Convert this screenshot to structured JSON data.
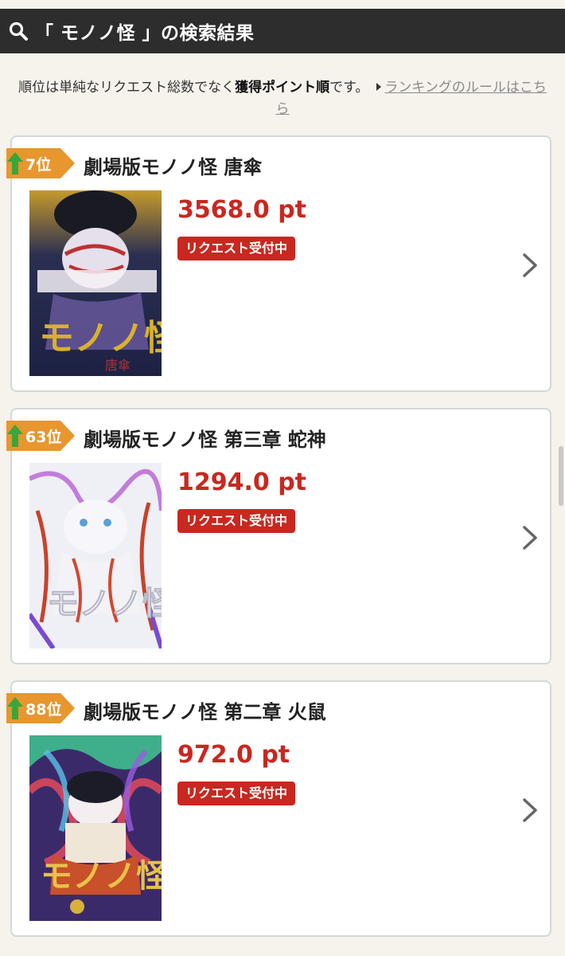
{
  "header": {
    "title": "「 モノノ怪 」の検索結果",
    "icon": "search-icon"
  },
  "notice": {
    "text_before": "順位は単純なリクエスト総数でなく",
    "text_bold": "獲得ポイント順",
    "text_after": "です。",
    "link_text": "ランキングのルールはこちら"
  },
  "results": [
    {
      "rank": "7位",
      "title": "劇場版モノノ怪 唐傘",
      "points": "3568.0 pt",
      "status": "リクエスト受付中"
    },
    {
      "rank": "63位",
      "title": "劇場版モノノ怪 第三章 蛇神",
      "points": "1294.0 pt",
      "status": "リクエスト受付中"
    },
    {
      "rank": "88位",
      "title": "劇場版モノノ怪 第二章 火鼠",
      "points": "972.0 pt",
      "status": "リクエスト受付中"
    }
  ],
  "colors": {
    "header_bg": "#2d2d2d",
    "accent_red": "#c8281f",
    "badge_orange": "#e8962e",
    "up_green": "#3aa63a",
    "page_bg": "#f6f2ec"
  }
}
